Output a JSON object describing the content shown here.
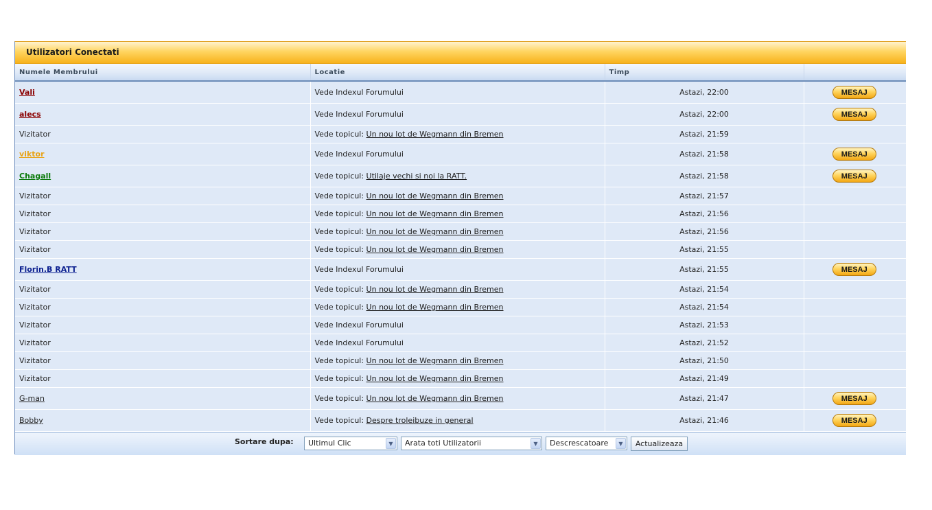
{
  "panel": {
    "title": "Utilizatori Conectati"
  },
  "columns": {
    "member": "Numele Membrului",
    "location": "Locatie",
    "time": "Timp"
  },
  "rows": [
    {
      "name": "Vali",
      "kind": "member",
      "color": "#8b0000",
      "bold": true,
      "location_prefix": "Vede Indexul Forumului",
      "topic": "",
      "time": "Astazi, 22:00",
      "button": "MESAJ"
    },
    {
      "name": "alecs",
      "kind": "member",
      "color": "#8b0000",
      "bold": true,
      "location_prefix": "Vede Indexul Forumului",
      "topic": "",
      "time": "Astazi, 22:00",
      "button": "MESAJ"
    },
    {
      "name": "Vizitator",
      "kind": "guest",
      "location_prefix": "Vede topicul: ",
      "topic": "Un nou lot de Wegmann din Bremen",
      "time": "Astazi, 21:59",
      "button": ""
    },
    {
      "name": "viktor",
      "kind": "member",
      "color": "#e8a317",
      "bold": true,
      "location_prefix": "Vede Indexul Forumului",
      "topic": "",
      "time": "Astazi, 21:58",
      "button": "MESAJ"
    },
    {
      "name": "Chagall",
      "kind": "member",
      "color": "#0a7a0a",
      "bold": true,
      "location_prefix": "Vede topicul: ",
      "topic": "Utilaje vechi si noi la RATT.",
      "time": "Astazi, 21:58",
      "button": "MESAJ"
    },
    {
      "name": "Vizitator",
      "kind": "guest",
      "location_prefix": "Vede topicul: ",
      "topic": "Un nou lot de Wegmann din Bremen",
      "time": "Astazi, 21:57",
      "button": ""
    },
    {
      "name": "Vizitator",
      "kind": "guest",
      "location_prefix": "Vede topicul: ",
      "topic": "Un nou lot de Wegmann din Bremen",
      "time": "Astazi, 21:56",
      "button": ""
    },
    {
      "name": "Vizitator",
      "kind": "guest",
      "location_prefix": "Vede topicul: ",
      "topic": "Un nou lot de Wegmann din Bremen",
      "time": "Astazi, 21:56",
      "button": ""
    },
    {
      "name": "Vizitator",
      "kind": "guest",
      "location_prefix": "Vede topicul: ",
      "topic": "Un nou lot de Wegmann din Bremen",
      "time": "Astazi, 21:55",
      "button": ""
    },
    {
      "name": "Florin.B RATT",
      "kind": "member",
      "color": "#0b1f8f",
      "bold": true,
      "location_prefix": "Vede Indexul Forumului",
      "topic": "",
      "time": "Astazi, 21:55",
      "button": "MESAJ"
    },
    {
      "name": "Vizitator",
      "kind": "guest",
      "location_prefix": "Vede topicul: ",
      "topic": "Un nou lot de Wegmann din Bremen",
      "time": "Astazi, 21:54",
      "button": ""
    },
    {
      "name": "Vizitator",
      "kind": "guest",
      "location_prefix": "Vede topicul: ",
      "topic": "Un nou lot de Wegmann din Bremen",
      "time": "Astazi, 21:54",
      "button": ""
    },
    {
      "name": "Vizitator",
      "kind": "guest",
      "location_prefix": "Vede Indexul Forumului",
      "topic": "",
      "time": "Astazi, 21:53",
      "button": ""
    },
    {
      "name": "Vizitator",
      "kind": "guest",
      "location_prefix": "Vede Indexul Forumului",
      "topic": "",
      "time": "Astazi, 21:52",
      "button": ""
    },
    {
      "name": "Vizitator",
      "kind": "guest",
      "location_prefix": "Vede topicul: ",
      "topic": "Un nou lot de Wegmann din Bremen",
      "time": "Astazi, 21:50",
      "button": ""
    },
    {
      "name": "Vizitator",
      "kind": "guest",
      "location_prefix": "Vede topicul: ",
      "topic": "Un nou lot de Wegmann din Bremen",
      "time": "Astazi, 21:49",
      "button": ""
    },
    {
      "name": "G-man",
      "kind": "member",
      "color": "#222222",
      "bold": false,
      "location_prefix": "Vede topicul: ",
      "topic": "Un nou lot de Wegmann din Bremen",
      "time": "Astazi, 21:47",
      "button": "MESAJ"
    },
    {
      "name": "Bobby",
      "kind": "member",
      "color": "#222222",
      "bold": false,
      "location_prefix": "Vede topicul: ",
      "topic": "Despre troleibuze in general",
      "time": "Astazi, 21:46",
      "button": "MESAJ"
    }
  ],
  "footer": {
    "sort_label": "Sortare dupa:",
    "sort_by": "Ultimul Clic",
    "filter": "Arata toti Utilizatorii",
    "order": "Descrescatoare",
    "update_button": "Actualizeaza"
  },
  "icons": {
    "dropdown": "chevron-down-icon"
  }
}
